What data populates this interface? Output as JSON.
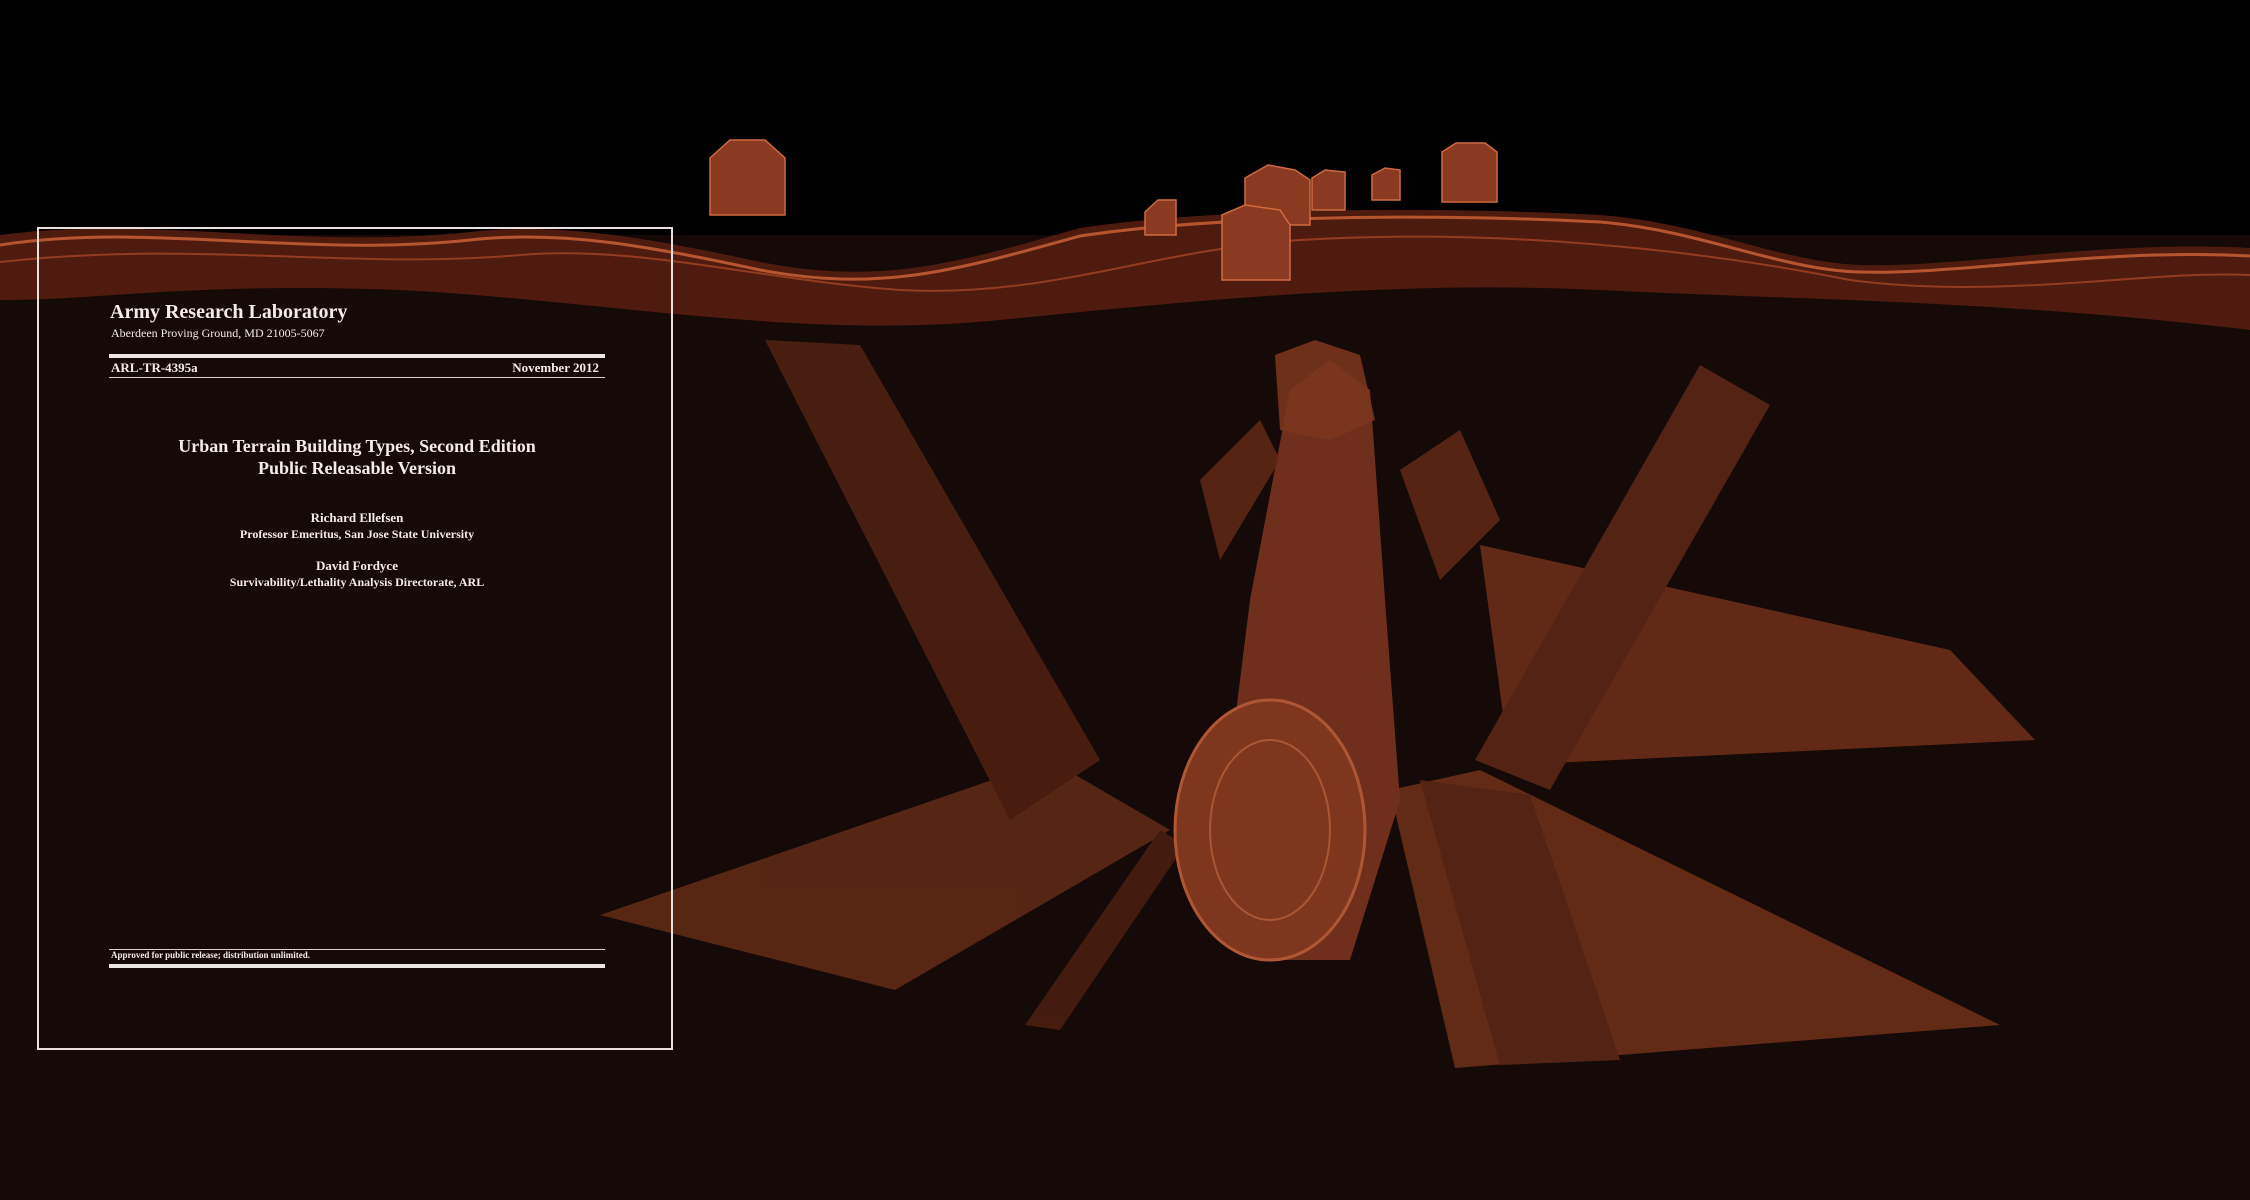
{
  "report": {
    "lab_name": "Army Research Laboratory",
    "lab_address": "Aberdeen Proving Ground, MD  21005-5067",
    "report_number": "ARL-TR-4395a",
    "date": "November 2012",
    "title_line_1": "Urban Terrain Building Types, Second Edition",
    "title_line_2": "Public Releasable Version",
    "authors": [
      {
        "name": "Richard Ellefsen",
        "affiliation": "Professor Emeritus, San Jose State University"
      },
      {
        "name": "David Fordyce",
        "affiliation": "Survivability/Lethality Analysis Directorate, ARL"
      }
    ],
    "distribution": "Approved for public release; distribution unlimited."
  },
  "scene": {
    "accent": "#c8552d",
    "background": "#150a07",
    "sky": "#000000"
  }
}
